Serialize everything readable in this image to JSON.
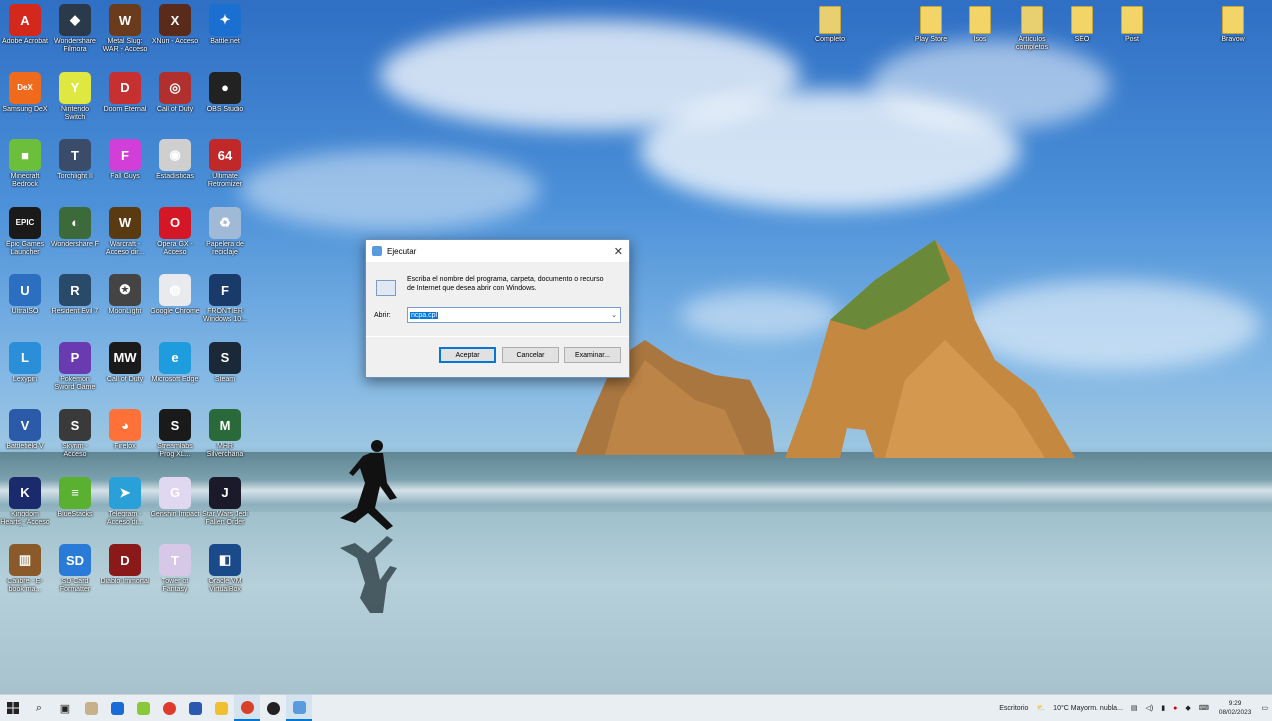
{
  "desktop": {
    "icons": [
      {
        "label": "Adobe Acrobat",
        "icon": "pdf-icon",
        "color": "#d4281c",
        "glyph": "A"
      },
      {
        "label": "Wondershare Filmora",
        "icon": "filmora-icon",
        "color": "#2a3a4a",
        "glyph": "◆"
      },
      {
        "label": "Metal Slug: WAR - Acceso dir...",
        "icon": "game-icon",
        "color": "#6b3b1d",
        "glyph": "W"
      },
      {
        "label": "XNuri - Acceso",
        "icon": "game-icon",
        "color": "#5a2a1a",
        "glyph": "X"
      },
      {
        "label": "Battle.net",
        "icon": "battlenet-icon",
        "color": "#1a6fd1",
        "glyph": "✦"
      },
      {
        "label": "Samsung DeX",
        "icon": "dex-icon",
        "color": "#f06a1c",
        "glyph": "DeX"
      },
      {
        "label": "Nintendo Switch",
        "icon": "yuzu-icon",
        "color": "#dfe840",
        "glyph": "Y"
      },
      {
        "label": "Doom Eternal",
        "icon": "game-icon",
        "color": "#c73030",
        "glyph": "D"
      },
      {
        "label": "Call of Duty",
        "icon": "game-icon",
        "color": "#b03030",
        "glyph": "◎"
      },
      {
        "label": "OBS Studio",
        "icon": "obs-icon",
        "color": "#222222",
        "glyph": "●"
      },
      {
        "label": "Minecraft Bedrock",
        "icon": "cube-icon",
        "color": "#6bbf3b",
        "glyph": "■"
      },
      {
        "label": "Torchlight II",
        "icon": "game-icon",
        "color": "#3a4c6a",
        "glyph": "T"
      },
      {
        "label": "Fall Guys",
        "icon": "game-icon",
        "color": "#d23fd8",
        "glyph": "F"
      },
      {
        "label": "Estadísticas",
        "icon": "disc-icon",
        "color": "#cfcfcf",
        "glyph": "◉"
      },
      {
        "label": "Ultimate Retromizer",
        "icon": "game-icon",
        "color": "#c0282a",
        "glyph": "64"
      },
      {
        "label": "Epic Games Launcher",
        "icon": "epic-icon",
        "color": "#1a1a1a",
        "glyph": "EPIC"
      },
      {
        "label": "Wondershare F",
        "icon": "game-icon",
        "color": "#3d6a3a",
        "glyph": "◐"
      },
      {
        "label": "Warcraft - Acceso dir...",
        "icon": "wow-icon",
        "color": "#5a3a10",
        "glyph": "W"
      },
      {
        "label": "Opera GX - Acceso",
        "icon": "opera-icon",
        "color": "#d31727",
        "glyph": "O"
      },
      {
        "label": "Papelera de reciclaje",
        "icon": "recycle-bin-icon",
        "color": "#9fb9d6",
        "glyph": "♻"
      },
      {
        "label": "UltraISO",
        "icon": "iso-icon",
        "color": "#2c6fc0",
        "glyph": "U"
      },
      {
        "label": "Resident Evil 7",
        "icon": "game-icon",
        "color": "#2a4a6a",
        "glyph": "R"
      },
      {
        "label": "MoonLight",
        "icon": "wheel-icon",
        "color": "#444444",
        "glyph": "✪"
      },
      {
        "label": "Google Chrome",
        "icon": "chrome-icon",
        "color": "#e8eaed",
        "glyph": "◍"
      },
      {
        "label": "FRONTIER Windows 10...",
        "icon": "game-icon",
        "color": "#1a3a6a",
        "glyph": "F"
      },
      {
        "label": "Lexypin",
        "icon": "app-icon",
        "color": "#2a8fd8",
        "glyph": "L"
      },
      {
        "label": "Pokemon Sword Game",
        "icon": "game-icon",
        "color": "#6a3ab0",
        "glyph": "P"
      },
      {
        "label": "Call of Duty",
        "icon": "mw-icon",
        "color": "#1a1a1a",
        "glyph": "MW"
      },
      {
        "label": "Microsoft Edge",
        "icon": "edge-icon",
        "color": "#1f9cdd",
        "glyph": "e"
      },
      {
        "label": "Steam",
        "icon": "steam-icon",
        "color": "#1b2838",
        "glyph": "S"
      },
      {
        "label": "Battlefield V",
        "icon": "game-icon",
        "color": "#2a5aa8",
        "glyph": "V"
      },
      {
        "label": "Skyrim - Acceso",
        "icon": "game-icon",
        "color": "#3a3a3a",
        "glyph": "S"
      },
      {
        "label": "Firefox",
        "icon": "firefox-icon",
        "color": "#ff7139",
        "glyph": "◕"
      },
      {
        "label": "Streamlabs Prog XL...",
        "icon": "app-icon",
        "color": "#1a1a1a",
        "glyph": "S"
      },
      {
        "label": "MHR Silverchana",
        "icon": "game-icon",
        "color": "#2a6a3a",
        "glyph": "M"
      },
      {
        "label": "Kingdom Hearts - Acceso dir...",
        "icon": "game-icon",
        "color": "#1a2a6a",
        "glyph": "K"
      },
      {
        "label": "BlueStacks",
        "icon": "bluestacks-icon",
        "color": "#5ab030",
        "glyph": "≡"
      },
      {
        "label": "Telegram - Acceso di...",
        "icon": "telegram-icon",
        "color": "#2aa0d8",
        "glyph": "➤"
      },
      {
        "label": "Genshin Impact",
        "icon": "game-icon",
        "color": "#e0d8f0",
        "glyph": "G"
      },
      {
        "label": "Star Wars Jedi Fallen Order",
        "icon": "game-icon",
        "color": "#1a1a2a",
        "glyph": "J"
      },
      {
        "label": "Calibre - E-book ma...",
        "icon": "books-icon",
        "color": "#8a5a2a",
        "glyph": "▥"
      },
      {
        "label": "SD Card Formatter",
        "icon": "sdcard-icon",
        "color": "#2a7ad8",
        "glyph": "SD"
      },
      {
        "label": "Diablo Immortal",
        "icon": "game-icon",
        "color": "#8a1a1a",
        "glyph": "D"
      },
      {
        "label": "Tower of Fantasy",
        "icon": "game-icon",
        "color": "#d8c8e8",
        "glyph": "T"
      },
      {
        "label": "Oracle VM VirtualBox",
        "icon": "virtualbox-icon",
        "color": "#1a4a8a",
        "glyph": "◧"
      }
    ],
    "right_icons": [
      {
        "label": "Completo",
        "icon": "zip-folder-icon"
      },
      {
        "label": "Play Store",
        "icon": "folder-icon"
      },
      {
        "label": "Isos",
        "icon": "folder-icon"
      },
      {
        "label": "Artículos completos",
        "icon": "zip-folder-icon"
      },
      {
        "label": "SEO",
        "icon": "folder-icon"
      },
      {
        "label": "Post",
        "icon": "folder-icon"
      },
      {
        "label": "Bravow",
        "icon": "folder-icon"
      }
    ]
  },
  "run_dialog": {
    "title": "Ejecutar",
    "description": "Escriba el nombre del programa, carpeta, documento o recurso de Internet que desea abrir con Windows.",
    "open_label": "Abrir:",
    "open_value": "ncpa.cpl",
    "ok_label": "Aceptar",
    "cancel_label": "Cancelar",
    "browse_label": "Examinar..."
  },
  "taskbar": {
    "desktop_label": "Escritorio",
    "weather": "10°C  Mayorm. nubla...",
    "time": "9:29",
    "date": "08/02/2023"
  }
}
